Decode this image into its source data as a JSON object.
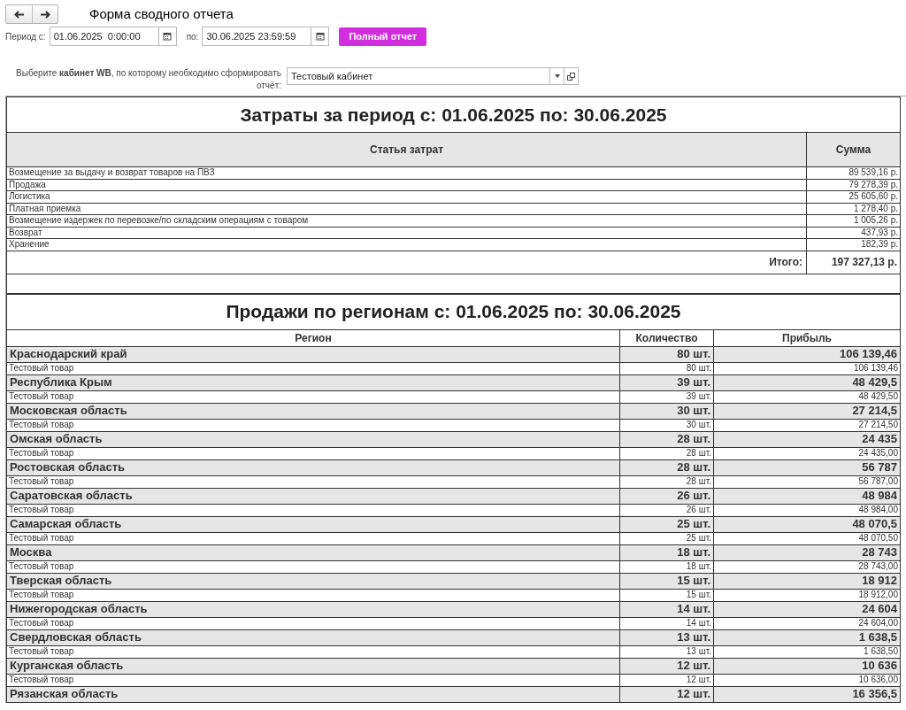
{
  "window": {
    "title": "Форма сводного отчета"
  },
  "period": {
    "from_label": "Период с:",
    "from_value": "01.06.2025  0:00:00",
    "to_label": "по:",
    "to_value": "30.06.2025 23:59:59"
  },
  "full_report_button": "Полный отчет",
  "cabinet": {
    "label": "Выберите **кабинет WB**, по которому необходимо сформировать отчёт:",
    "value": "Тестовый кабинет"
  },
  "costs": {
    "title": "Затраты за период с: 01.06.2025 по: 30.06.2025",
    "columns": [
      "Статья затрат",
      "Сумма"
    ],
    "rows": [
      {
        "item": "Возмещение за выдачу и возврат товаров на ПВЗ",
        "sum": "89 539,16 р."
      },
      {
        "item": "Продажа",
        "sum": "79 278,39 р."
      },
      {
        "item": "Логистика",
        "sum": "25 605,60 р."
      },
      {
        "item": "Платная приемка",
        "sum": "1 278,40 р."
      },
      {
        "item": "Возмещение издержек по перевозке/по складским операциям с товаром",
        "sum": "1 005,26 р."
      },
      {
        "item": "Возврат",
        "sum": "437,93 р."
      },
      {
        "item": "Хранение",
        "sum": "182,39 р."
      }
    ],
    "total_label": "Итого:",
    "total_value": "197 327,13 р."
  },
  "sales": {
    "title": "Продажи по регионам с: 01.06.2025 по: 30.06.2025",
    "columns": [
      "Регион",
      "Количество",
      "Прибыль"
    ],
    "regions": [
      {
        "name": "Краснодарский край",
        "qty": "80 шт.",
        "profit": "106 139,46",
        "items": [
          {
            "name": "Тестовый товар",
            "qty": "80 шт.",
            "profit": "106 139,46"
          }
        ]
      },
      {
        "name": "Республика Крым",
        "qty": "39 шт.",
        "profit": "48 429,5",
        "items": [
          {
            "name": "Тестовый товар",
            "qty": "39 шт.",
            "profit": "48 429,50"
          }
        ]
      },
      {
        "name": "Московская область",
        "qty": "30 шт.",
        "profit": "27 214,5",
        "items": [
          {
            "name": "Тестовый товар",
            "qty": "30 шт.",
            "profit": "27 214,50"
          }
        ]
      },
      {
        "name": "Омская область",
        "qty": "28 шт.",
        "profit": "24 435",
        "items": [
          {
            "name": "Тестовый товар",
            "qty": "28 шт.",
            "profit": "24 435,00"
          }
        ]
      },
      {
        "name": "Ростовская область",
        "qty": "28 шт.",
        "profit": "56 787",
        "items": [
          {
            "name": "Тестовый товар",
            "qty": "28 шт.",
            "profit": "56 787,00"
          }
        ]
      },
      {
        "name": "Саратовская область",
        "qty": "26 шт.",
        "profit": "48 984",
        "items": [
          {
            "name": "Тестовый товар",
            "qty": "26 шт.",
            "profit": "48 984,00"
          }
        ]
      },
      {
        "name": "Самарская область",
        "qty": "25 шт.",
        "profit": "48 070,5",
        "items": [
          {
            "name": "Тестовый товар",
            "qty": "25 шт.",
            "profit": "48 070,50"
          }
        ]
      },
      {
        "name": "Москва",
        "qty": "18 шт.",
        "profit": "28 743",
        "items": [
          {
            "name": "Тестовый товар",
            "qty": "18 шт.",
            "profit": "28 743,00"
          }
        ]
      },
      {
        "name": "Тверская область",
        "qty": "15 шт.",
        "profit": "18 912",
        "items": [
          {
            "name": "Тестовый товар",
            "qty": "15 шт.",
            "profit": "18 912,00"
          }
        ]
      },
      {
        "name": "Нижегородская область",
        "qty": "14 шт.",
        "profit": "24 604",
        "items": [
          {
            "name": "Тестовый товар",
            "qty": "14 шт.",
            "profit": "24 604,00"
          }
        ]
      },
      {
        "name": "Свердловская область",
        "qty": "13 шт.",
        "profit": "1 638,5",
        "items": [
          {
            "name": "Тестовый товар",
            "qty": "13 шт.",
            "profit": "1 638,50"
          }
        ]
      },
      {
        "name": "Курганская область",
        "qty": "12 шт.",
        "profit": "10 636",
        "items": [
          {
            "name": "Тестовый товар",
            "qty": "12 шт.",
            "profit": "10 636,00"
          }
        ]
      },
      {
        "name": "Рязанская область",
        "qty": "12 шт.",
        "profit": "16 356,5"
      }
    ]
  }
}
